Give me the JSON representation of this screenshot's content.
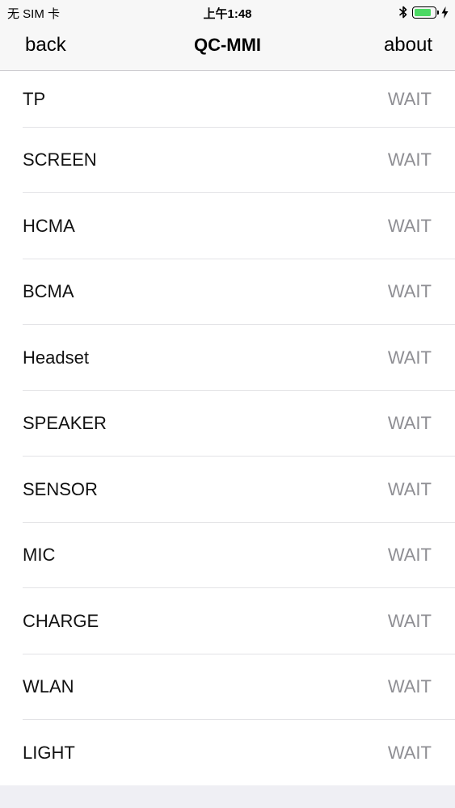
{
  "status_bar": {
    "carrier": "无 SIM 卡",
    "time": "上午1:48",
    "battery_level": 0.85,
    "battery_color": "#4cd964",
    "icons": [
      "bluetooth-icon",
      "battery-icon",
      "charging-bolt-icon"
    ]
  },
  "nav": {
    "back_label": "back",
    "title": "QC-MMI",
    "about_label": "about"
  },
  "tests": [
    {
      "label": "TP",
      "status": "WAIT"
    },
    {
      "label": "SCREEN",
      "status": "WAIT"
    },
    {
      "label": "HCMA",
      "status": "WAIT"
    },
    {
      "label": "BCMA",
      "status": "WAIT"
    },
    {
      "label": "Headset",
      "status": "WAIT"
    },
    {
      "label": "SPEAKER",
      "status": "WAIT"
    },
    {
      "label": "SENSOR",
      "status": "WAIT"
    },
    {
      "label": "MIC",
      "status": "WAIT"
    },
    {
      "label": "CHARGE",
      "status": "WAIT"
    },
    {
      "label": "WLAN",
      "status": "WAIT"
    },
    {
      "label": "LIGHT",
      "status": "WAIT"
    }
  ]
}
